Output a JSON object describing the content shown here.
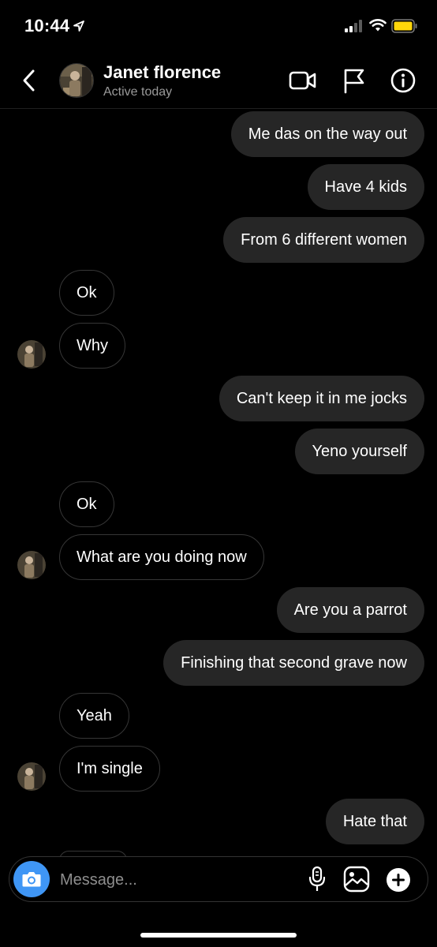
{
  "status_bar": {
    "time": "10:44"
  },
  "header": {
    "contact_name": "Janet florence",
    "contact_status": "Active today"
  },
  "messages": [
    {
      "dir": "out",
      "text": "Me das on the way out"
    },
    {
      "dir": "out",
      "text": "Have 4 kids"
    },
    {
      "dir": "out",
      "text": "From 6 different women"
    },
    {
      "dir": "in",
      "text": "Ok"
    },
    {
      "dir": "in",
      "text": "Why"
    },
    {
      "dir": "out",
      "text": "Can't keep it in me jocks"
    },
    {
      "dir": "out",
      "text": "Yeno yourself"
    },
    {
      "dir": "in",
      "text": "Ok"
    },
    {
      "dir": "in",
      "text": "What are you doing now"
    },
    {
      "dir": "out",
      "text": "Are you a parrot"
    },
    {
      "dir": "out",
      "text": "Finishing that second grave now"
    },
    {
      "dir": "in",
      "text": "Yeah"
    },
    {
      "dir": "in",
      "text": "I'm single"
    },
    {
      "dir": "out",
      "text": "Hate that"
    }
  ],
  "composer": {
    "placeholder": "Message..."
  },
  "icons": {
    "back": "chevron-left-icon",
    "video": "video-camera-icon",
    "flag": "flag-icon",
    "info": "info-icon",
    "camera": "camera-icon",
    "mic": "microphone-icon",
    "gallery": "gallery-icon",
    "plus": "plus-icon"
  },
  "colors": {
    "background": "#000000",
    "outgoing_bubble": "#262626",
    "camera_button": "#3f96f5",
    "secondary_text": "#9a9a9a"
  }
}
